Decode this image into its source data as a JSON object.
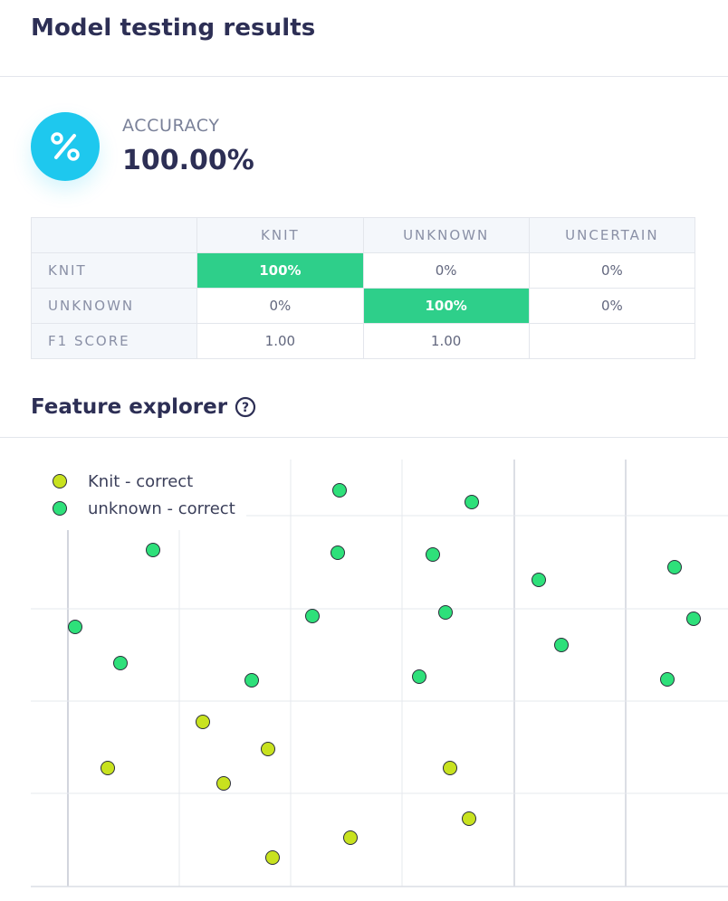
{
  "header": {
    "title": "Model testing results"
  },
  "accuracy": {
    "icon": "percent-icon",
    "icon_glyph": "%",
    "label": "ACCURACY",
    "value": "100.00%"
  },
  "matrix": {
    "columns": [
      "KNIT",
      "UNKNOWN",
      "UNCERTAIN"
    ],
    "rows": [
      {
        "label": "KNIT",
        "cells": [
          "100%",
          "0%",
          "0%"
        ]
      },
      {
        "label": "UNKNOWN",
        "cells": [
          "0%",
          "100%",
          "0%"
        ]
      },
      {
        "label": "F1 SCORE",
        "cells": [
          "1.00",
          "1.00",
          ""
        ]
      }
    ],
    "highlight_color": "#2ecf8a"
  },
  "feature_explorer": {
    "title": "Feature explorer",
    "help_icon": "question-circle-icon",
    "help_glyph": "?",
    "legend": [
      {
        "label": "Knit - correct",
        "color": "#c8e21f"
      },
      {
        "label": "unknown - correct",
        "color": "#2ee07a"
      }
    ]
  },
  "chart_data": {
    "type": "scatter",
    "title": "",
    "xlabel": "",
    "ylabel": "",
    "grid": true,
    "legend_position": "top-left",
    "series": [
      {
        "name": "Knit - correct",
        "color": "#c8e21f",
        "points": [
          [
            224,
            798
          ],
          [
            296,
            828
          ],
          [
            119,
            849
          ],
          [
            247,
            866
          ],
          [
            497,
            849
          ],
          [
            518,
            905
          ],
          [
            387,
            926
          ],
          [
            301,
            948
          ]
        ]
      },
      {
        "name": "unknown - correct",
        "color": "#2ee07a",
        "points": [
          [
            375,
            542
          ],
          [
            521,
            555
          ],
          [
            169,
            608
          ],
          [
            373,
            611
          ],
          [
            478,
            613
          ],
          [
            595,
            641
          ],
          [
            745,
            627
          ],
          [
            83,
            693
          ],
          [
            345,
            681
          ],
          [
            492,
            677
          ],
          [
            766,
            684
          ],
          [
            133,
            733
          ],
          [
            620,
            713
          ],
          [
            278,
            752
          ],
          [
            463,
            748
          ],
          [
            737,
            751
          ]
        ]
      }
    ]
  }
}
